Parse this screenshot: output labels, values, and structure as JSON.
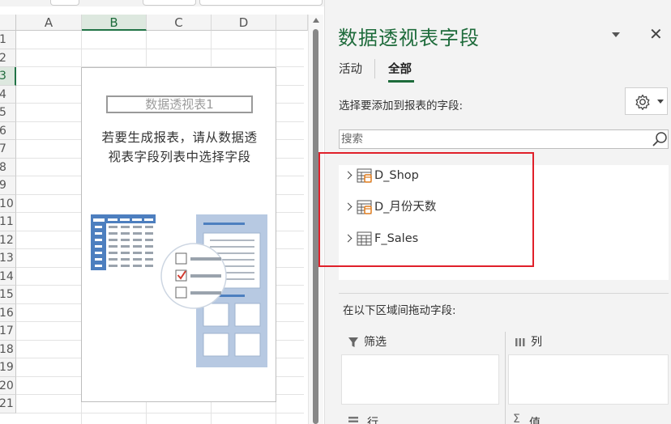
{
  "sheet": {
    "columns": [
      "A",
      "B",
      "C",
      "D"
    ],
    "selected_column": "B",
    "rows": [
      "1",
      "2",
      "3",
      "4",
      "5",
      "6",
      "7",
      "8",
      "9",
      "10",
      "11",
      "12",
      "13",
      "14",
      "15",
      "16",
      "17",
      "18",
      "19",
      "20",
      "21"
    ],
    "selected_row": "3",
    "pivot_placeholder": {
      "name": "数据透视表1",
      "hint_line1": "若要生成报表，请从数据透",
      "hint_line2": "视表字段列表中选择字段"
    }
  },
  "pane": {
    "title": "数据透视表字段",
    "tabs": [
      {
        "label": "活动",
        "active": false
      },
      {
        "label": "全部",
        "active": true
      }
    ],
    "choose_label": "选择要添加到报表的字段:",
    "search_placeholder": "搜索",
    "fields": [
      {
        "name": "D_Shop",
        "icon": "table-icon-orange"
      },
      {
        "name": "D_月份天数",
        "icon": "table-icon-orange"
      },
      {
        "name": "F_Sales",
        "icon": "table-icon"
      }
    ],
    "drag_label": "在以下区域间拖动字段:",
    "areas": [
      {
        "label": "筛选",
        "icon": "filter-icon"
      },
      {
        "label": "列",
        "icon": "columns-icon"
      },
      {
        "label": "行",
        "icon": "rows-icon"
      },
      {
        "label": "值",
        "icon": "sigma-icon"
      }
    ]
  },
  "colors": {
    "accent": "#217346",
    "title_green": "#1e6b3b",
    "highlight_red": "#e0202a",
    "illustration_blue": "#4d7fbf"
  }
}
